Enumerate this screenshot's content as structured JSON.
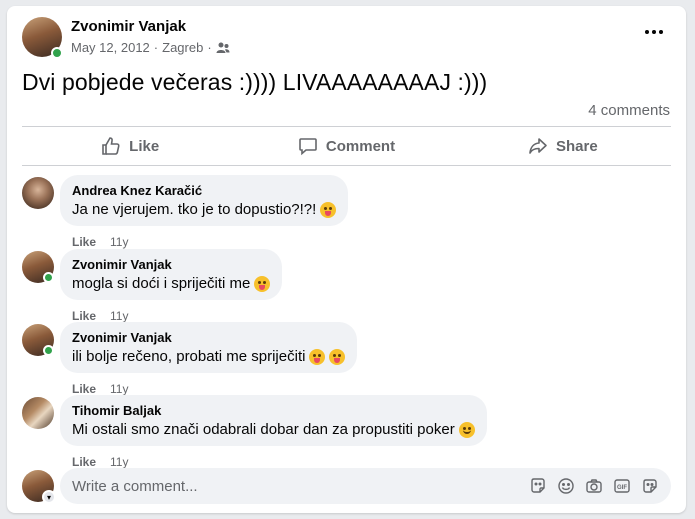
{
  "post": {
    "author": "Zvonimir Vanjak",
    "date": "May 12, 2012",
    "separator": "·",
    "location": "Zagreb",
    "separator2": "·",
    "audience_icon": "friends-icon",
    "text": "Dvi pobjede večeras :)))) LIVAAAAAAAAJ :)))",
    "comment_count": "4 comments",
    "more_icon": "more-options-icon"
  },
  "actions": {
    "like": "Like",
    "comment": "Comment",
    "share": "Share"
  },
  "comments": [
    {
      "author": "Andrea Knez Karačić",
      "text": "Ja ne vjerujem. tko je to dopustio?!?!",
      "emojis": [
        "tongue"
      ],
      "like": "Like",
      "time": "11y"
    },
    {
      "author": "Zvonimir Vanjak",
      "text": "mogla si doći i spriječiti me",
      "emojis": [
        "tongue"
      ],
      "like": "Like",
      "time": "11y"
    },
    {
      "author": "Zvonimir Vanjak",
      "text": "ili bolje rečeno, probati me spriječiti",
      "emojis": [
        "tongue",
        "tongue"
      ],
      "like": "Like",
      "time": "11y"
    },
    {
      "author": "Tihomir Baljak",
      "text": "Mi ostali smo znači odabrali dobar dan za propustiti poker",
      "emojis": [
        "smile"
      ],
      "like": "Like",
      "time": "11y"
    }
  ],
  "composer": {
    "placeholder": "Write a comment...",
    "icons": [
      "avatar-sticker-icon",
      "emoji-icon",
      "camera-icon",
      "gif-icon",
      "sticker-icon"
    ]
  },
  "colors": {
    "online": "#31a24c",
    "muted_text": "#65676b",
    "bubble": "#f0f2f5"
  }
}
